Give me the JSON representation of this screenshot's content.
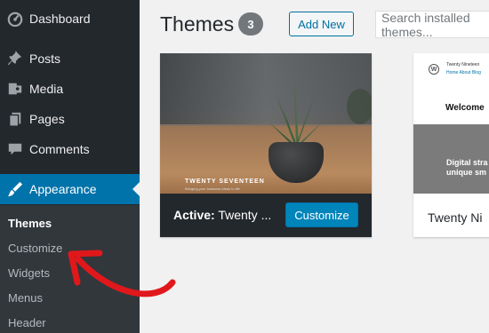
{
  "sidebar": {
    "items": [
      {
        "label": "Dashboard",
        "icon": "dashboard-icon"
      },
      {
        "label": "Posts",
        "icon": "pin-icon"
      },
      {
        "label": "Media",
        "icon": "media-icon"
      },
      {
        "label": "Pages",
        "icon": "pages-icon"
      },
      {
        "label": "Comments",
        "icon": "comments-icon"
      },
      {
        "label": "Appearance",
        "icon": "appearance-icon"
      }
    ],
    "submenu": [
      "Themes",
      "Customize",
      "Widgets",
      "Menus",
      "Header"
    ]
  },
  "header": {
    "title": "Themes",
    "count": "3",
    "add_new": "Add New",
    "search_placeholder": "Search installed themes..."
  },
  "themes": {
    "active": {
      "preview_title": "TWENTY SEVENTEEN",
      "preview_sub": "Bringing your business ideas to life",
      "active_prefix": "Active:",
      "name_truncated": "Twenty ...",
      "customize": "Customize"
    },
    "second": {
      "site_name": "Twenty Nineteen",
      "nav": "Home  About  Blog",
      "welcome": "Welcome",
      "digital_line1": "Digital stra",
      "digital_line2": "unique sm",
      "name_truncated": "Twenty Ni"
    }
  },
  "colors": {
    "sidebar_bg": "#23282d",
    "active_blue": "#0073aa",
    "arrow_red": "#e0181b"
  }
}
